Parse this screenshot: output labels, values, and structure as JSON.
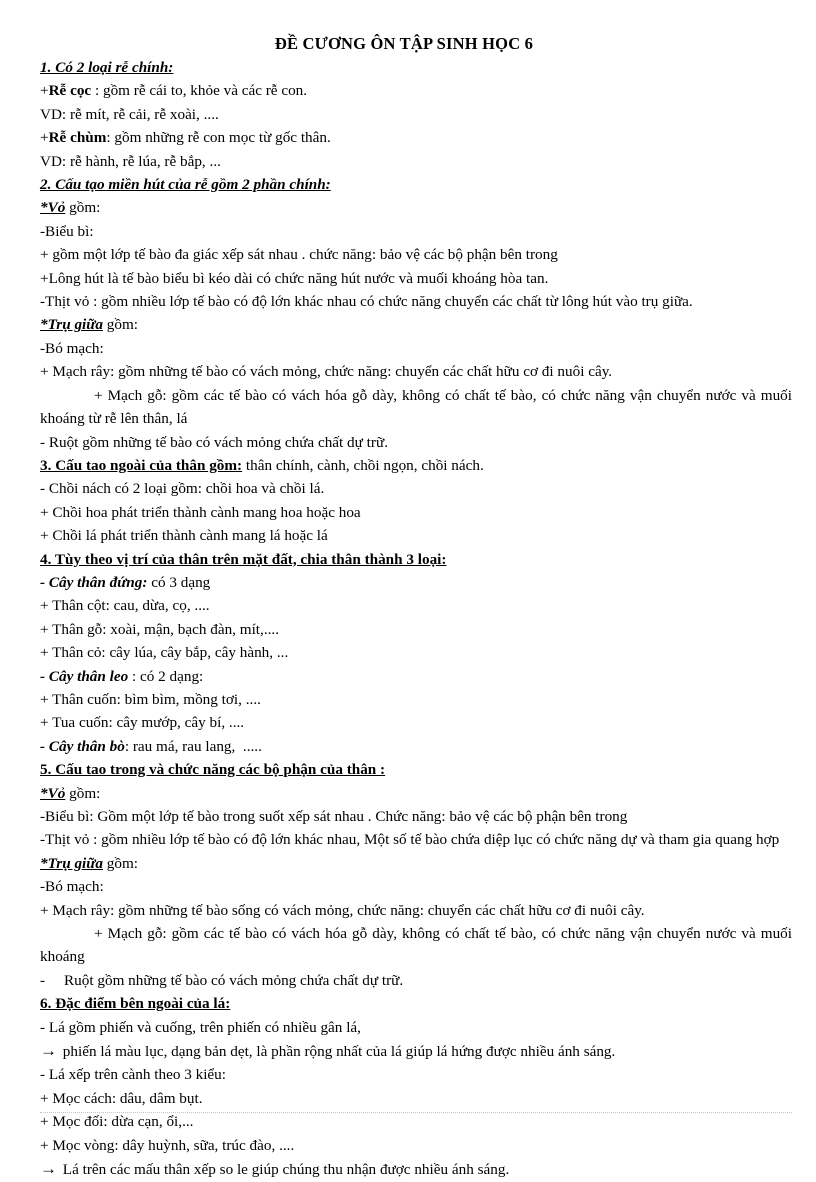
{
  "document": {
    "title": "ĐỀ CƯƠNG ÔN TẬP SINH HỌC 6",
    "sections": [
      {
        "number": "1.",
        "heading": "1. Có 2 loại rễ chính:",
        "lines": [
          {
            "lead": "+",
            "strong": "Rễ cọc",
            "rest": " : gồm rễ cái to, khỏe và các rễ con."
          },
          {
            "text": "VD: rễ mít, rễ cải, rễ xoài, ...."
          },
          {
            "lead": "+",
            "strong": "Rễ chùm",
            "rest": ": gồm những rễ con mọc từ gốc thân."
          },
          {
            "text": "VD: rễ hành, rễ lúa, rễ bắp, ..."
          }
        ]
      },
      {
        "number": "2.",
        "heading": "2. Cấu tạo miền hút của rễ gồm 2 phần chính:",
        "sub_heading_1": "*Vỏ",
        "sub_heading_1_rest": " gồm:",
        "lines": [
          {
            "text": "-Biểu bì:"
          },
          {
            "text": "+ gồm một lớp tế bào đa giác xếp sát nhau . chức năng: bảo vệ các bộ phận bên trong"
          },
          {
            "text": "+Lông hút là tế bào biểu bì kéo dài có chức năng hút nước và muối khoáng hòa tan."
          },
          {
            "text": "-Thịt vỏ : gồm nhiều lớp tế bào có độ lớn khác nhau có chức năng chuyển các chất từ lông hút vào trụ giữa."
          }
        ],
        "sub_heading_2": "*Trụ giữa",
        "sub_heading_2_rest": " gồm:",
        "lines2": [
          {
            "text": "-Bó mạch:"
          },
          {
            "text": "+ Mạch rây: gồm những tế bào có vách mỏng, chức năng: chuyển các chất hữu cơ đi nuôi cây."
          },
          {
            "text": "+ Mạch gỗ: gồm các tế bào có vách hóa gỗ dày, không có chất tế bào, có chức năng vận chuyển nước và muối khoáng từ rễ lên thân, lá"
          },
          {
            "text": "- Ruột gồm những tế bào có vách mỏng chứa chất dự trữ."
          }
        ]
      },
      {
        "number": "3.",
        "heading": "3. Cấu tao ngoài của thân gồm:",
        "heading_rest": " thân chính, cành, chồi ngọn, chồi nách.",
        "lines": [
          {
            "text": "- Chồi nách có 2 loại gồm: chồi hoa và chồi lá."
          },
          {
            "text": "+ Chồi hoa phát triển thành cành mang hoa hoặc hoa"
          },
          {
            "text": "+ Chồi lá phát triển thành cành mang lá hoặc lá"
          }
        ]
      },
      {
        "number": "4.",
        "heading": "4. Tùy theo vị trí của thân trên mặt đất, chia thân thành 3 loại:",
        "items": [
          {
            "strong": "- Cây thân đứng:",
            "rest": " có 3 dạng"
          },
          {
            "text": "+ Thân cột: cau, dừa, cọ, ...."
          },
          {
            "text": "+ Thân gỗ: xoài, mận, bạch đàn, mít,...."
          },
          {
            "text": "+ Thân cỏ: cây lúa, cây bắp, cây hành, ..."
          },
          {
            "strong": "- Cây thân leo",
            "rest": " : có 2 dạng:"
          },
          {
            "text": "+ Thân cuốn: bìm bìm, mồng tơi, ...."
          },
          {
            "text": "+ Tua cuốn: cây mướp, cây bí, ...."
          },
          {
            "strong": "- Cây thân bò",
            "rest": ": rau má, rau lang,  ....."
          }
        ]
      },
      {
        "number": "5.",
        "heading": "5. Cấu tao trong và chức năng các bộ phận của thân :",
        "sub_heading_1": "*Vỏ",
        "sub_heading_1_rest": " gồm:",
        "lines": [
          {
            "text": "-Biểu bì: Gồm một lớp tế bào trong suốt xếp sát nhau . Chức năng: bảo vệ các bộ phận bên trong"
          },
          {
            "text": "-Thịt vỏ : gồm nhiều lớp tế bào có độ lớn khác nhau, Một số tế bào chứa diệp lục có chức năng dự và tham gia quang hợp"
          }
        ],
        "sub_heading_2": "*Trụ giữa",
        "sub_heading_2_rest": " gồm:",
        "lines2": [
          {
            "text": "-Bó mạch:"
          },
          {
            "text": "+ Mạch rây: gồm những tế bào sống có vách mỏng, chức năng: chuyển các chất hữu cơ đi nuôi cây."
          },
          {
            "text": "+ Mạch gỗ: gồm các tế bào có vách hóa gỗ dày, không có chất tế bào, có chức năng vận chuyển nước và muối khoáng"
          },
          {
            "text": "-     Ruột gồm những tế bào có vách mỏng chứa chất dự trữ."
          }
        ]
      },
      {
        "number": "6.",
        "heading": "6. Đặc điểm bên ngoài của lá:",
        "lines": [
          {
            "text": "- Lá gồm phiến và cuống, trên phiến có nhiều gân lá,"
          },
          {
            "arrow": "→",
            "text": " phiến lá màu lục, dạng bản dẹt, là phần rộng nhất của lá giúp lá hứng được nhiều ánh sáng."
          },
          {
            "text": "- Lá xếp trên cành theo 3 kiểu:"
          },
          {
            "text": "+ Mọc cách: dâu, dâm bụt."
          },
          {
            "text": "+ Mọc đối: dừa cạn, ổi,..."
          },
          {
            "text": "+ Mọc vòng: dây huỳnh, sữa, trúc đào, ...."
          },
          {
            "arrow": "→",
            "text": " Lá trên các mấu thân xếp so le giúp chúng thu nhận được nhiều ánh sáng."
          }
        ]
      }
    ]
  }
}
